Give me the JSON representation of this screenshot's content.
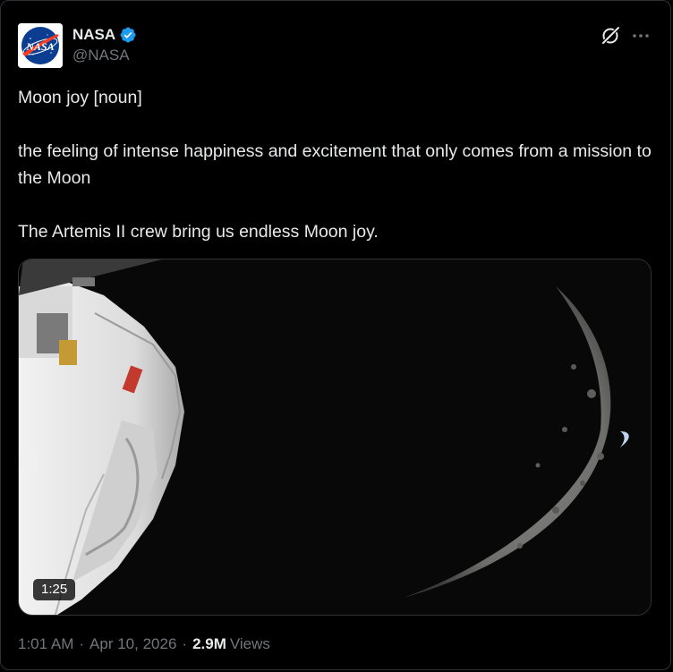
{
  "author": {
    "display_name": "NASA",
    "handle": "@NASA",
    "verified": true,
    "avatar_icon": "nasa-meatball-logo",
    "avatar_text": "NASA"
  },
  "actions": {
    "grok_icon": "grok-icon",
    "more_icon": "more-horizontal-icon"
  },
  "tweet": {
    "lines": [
      "Moon joy [noun]",
      "the feeling of intense happiness and excitement that only comes from a mission to the Moon",
      "The Artemis II crew bring us endless Moon joy."
    ]
  },
  "media": {
    "type": "video",
    "duration": "1:25",
    "description_icon": "orion-spacecraft-moon-video"
  },
  "meta": {
    "time": "1:01 AM",
    "date": "Apr 10, 2026",
    "views_count": "2.9M",
    "views_label": "Views",
    "separator": "·"
  },
  "colors": {
    "background": "#000000",
    "text_primary": "#e7e9ea",
    "text_secondary": "#71767b",
    "verified_blue": "#1d9bf0",
    "border": "#2f3336"
  }
}
